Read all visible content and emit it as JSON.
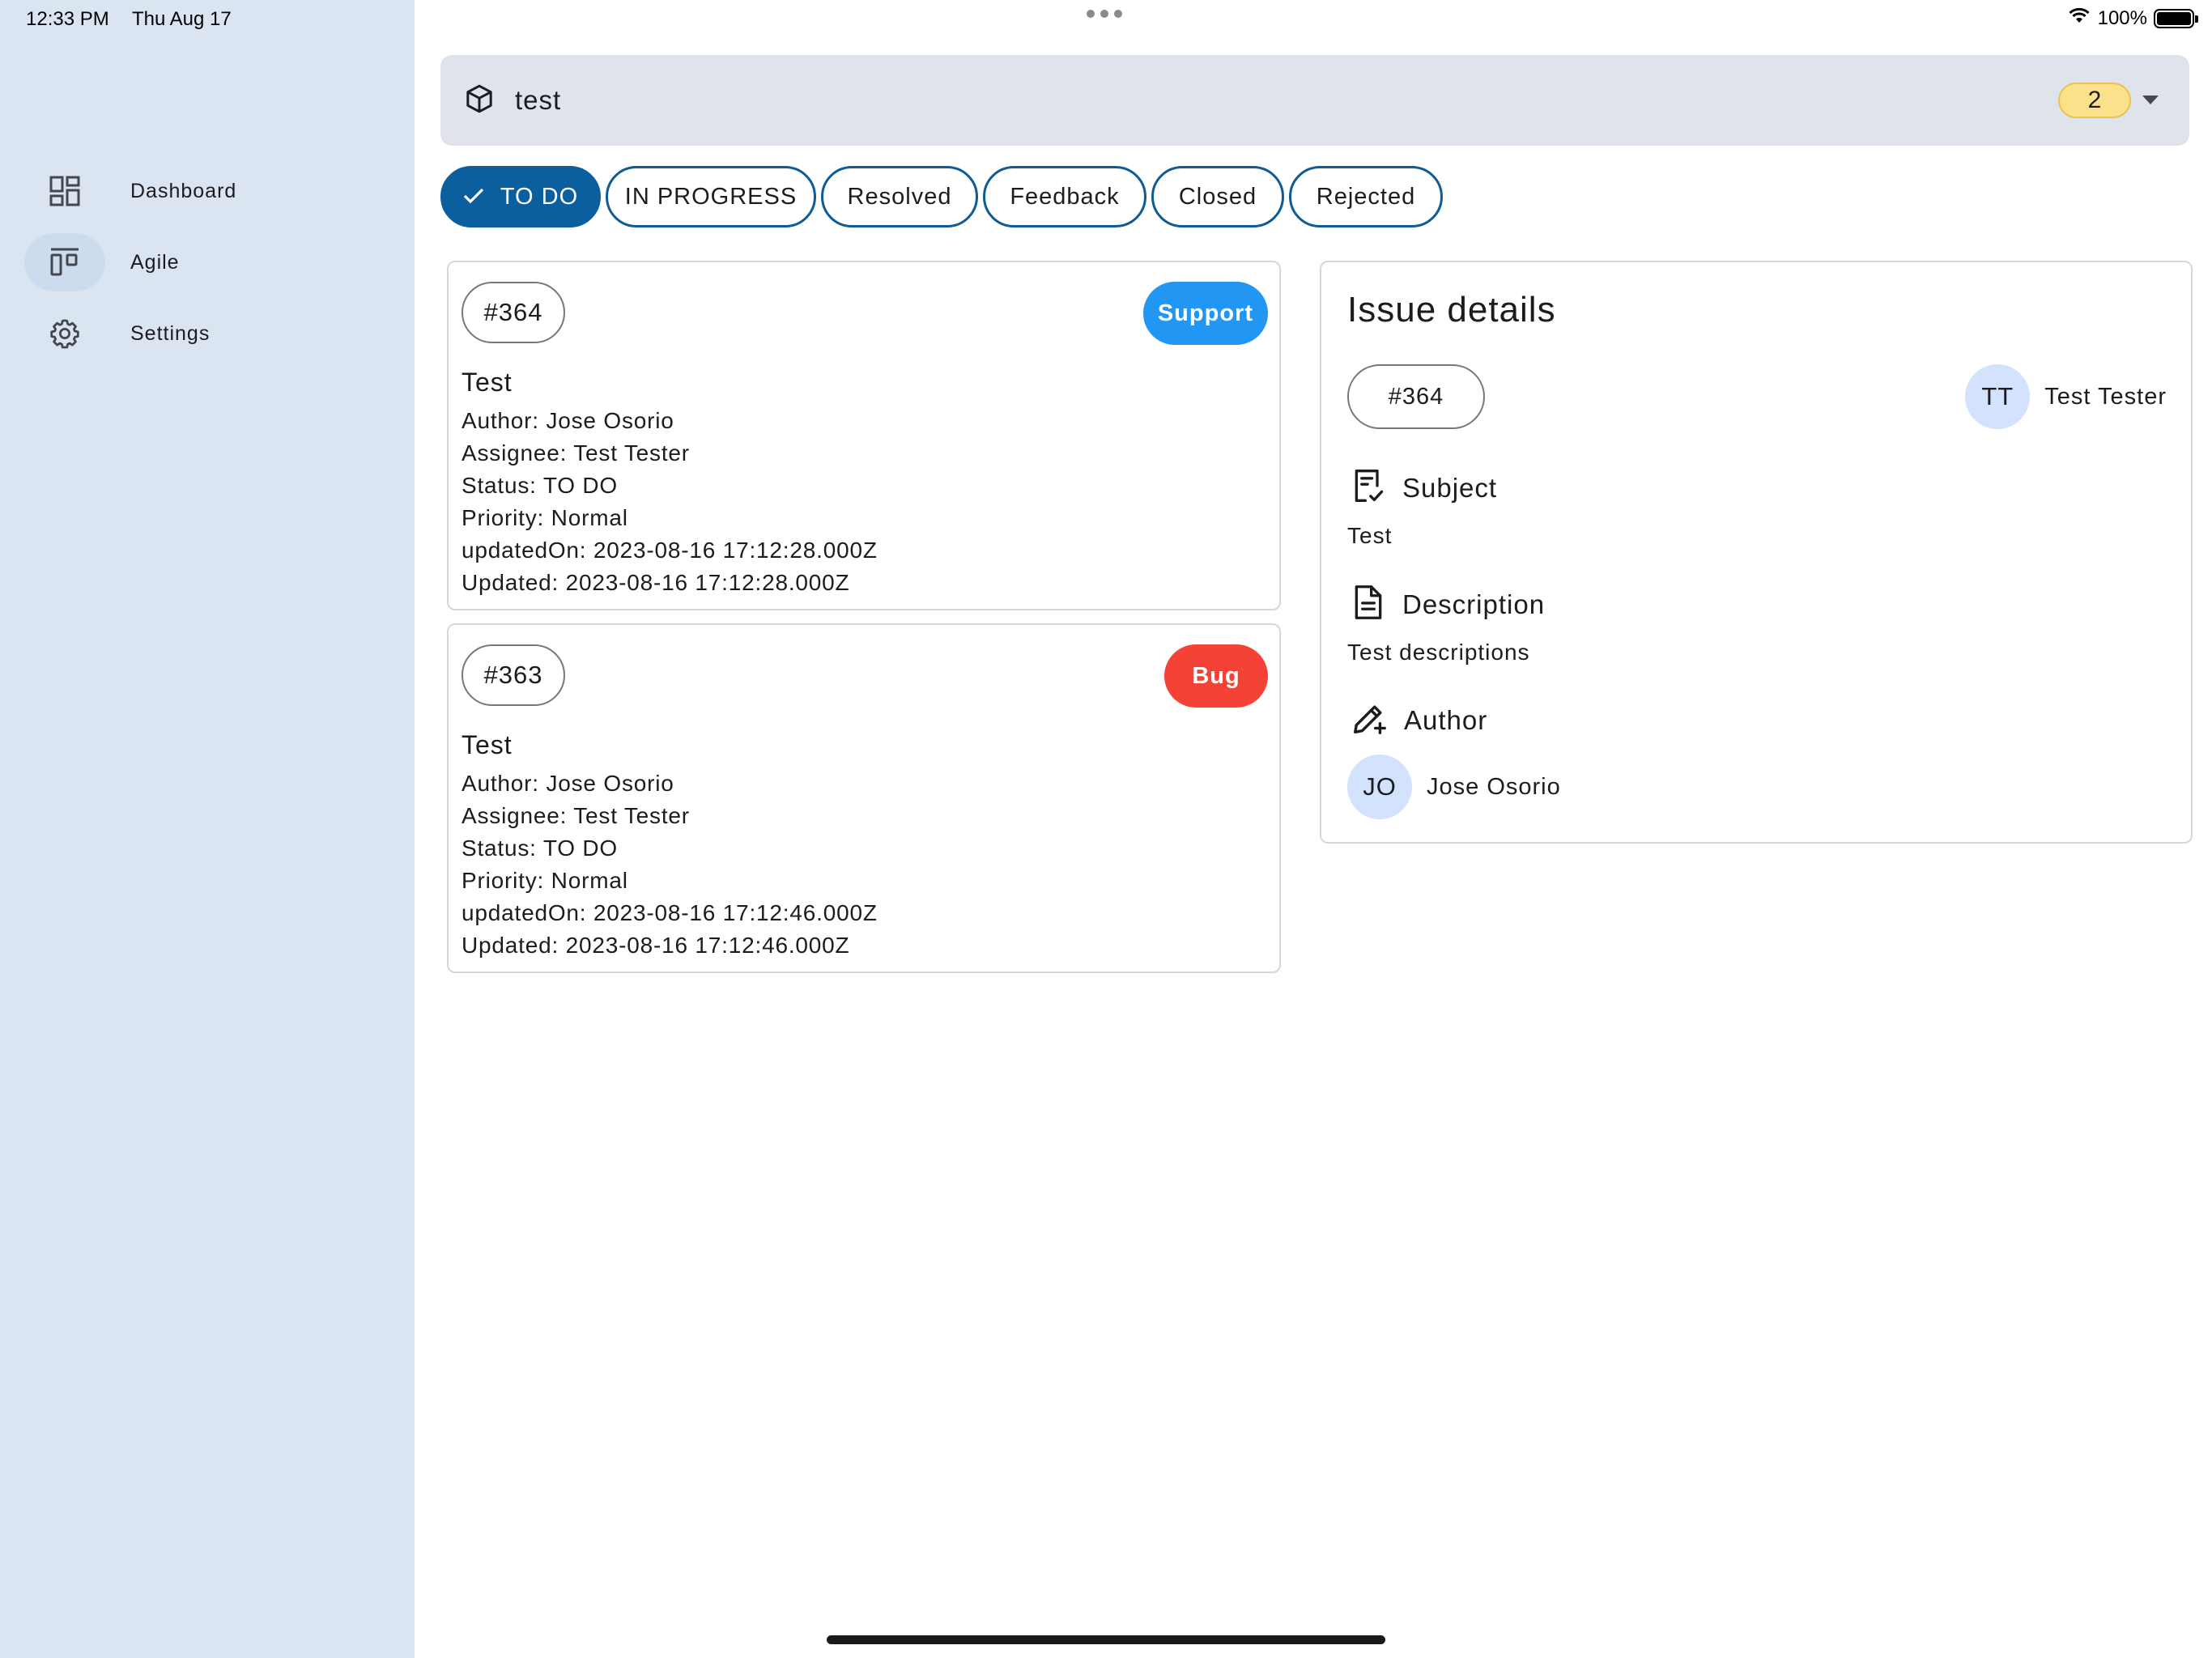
{
  "status_bar": {
    "time": "12:33 PM",
    "date": "Thu Aug 17",
    "battery": "100%"
  },
  "sidebar": {
    "items": [
      {
        "label": "Dashboard",
        "icon": "dashboard-icon"
      },
      {
        "label": "Agile",
        "icon": "agile-board-icon",
        "active": true
      },
      {
        "label": "Settings",
        "icon": "gear-icon"
      }
    ]
  },
  "project": {
    "name": "test",
    "icon": "cube-icon",
    "count": "2"
  },
  "status_filters": [
    {
      "label": "TO DO",
      "selected": true
    },
    {
      "label": "IN PROGRESS"
    },
    {
      "label": "Resolved"
    },
    {
      "label": "Feedback"
    },
    {
      "label": "Closed"
    },
    {
      "label": "Rejected"
    }
  ],
  "issues": [
    {
      "id": "#364",
      "tag": "Support",
      "tag_color": "#2196f3",
      "title": "Test",
      "author": "Author: Jose Osorio",
      "assignee": "Assignee: Test Tester",
      "status": "Status: TO DO",
      "priority": "Priority: Normal",
      "updated_on": "updatedOn: 2023-08-16 17:12:28.000Z",
      "updated": "Updated: 2023-08-16 17:12:28.000Z"
    },
    {
      "id": "#363",
      "tag": "Bug",
      "tag_color": "#f44336",
      "title": "Test",
      "author": "Author: Jose Osorio",
      "assignee": "Assignee: Test Tester",
      "status": "Status: TO DO",
      "priority": "Priority: Normal",
      "updated_on": "updatedOn: 2023-08-16 17:12:46.000Z",
      "updated": "Updated: 2023-08-16 17:12:46.000Z"
    }
  ],
  "details": {
    "title": "Issue details",
    "id": "#364",
    "assignee_initials": "TT",
    "assignee_name": "Test Tester",
    "subject_label": "Subject",
    "subject_value": "Test",
    "description_label": "Description",
    "description_value": "Test descriptions",
    "author_label": "Author",
    "author_initials": "JO",
    "author_name": "Jose Osorio"
  },
  "colors": {
    "sidebar_bg": "#dae5f1",
    "primary": "#0c5f9e",
    "support_tag": "#2196f3",
    "bug_tag": "#f44336",
    "count_badge": "#fbe28a"
  }
}
